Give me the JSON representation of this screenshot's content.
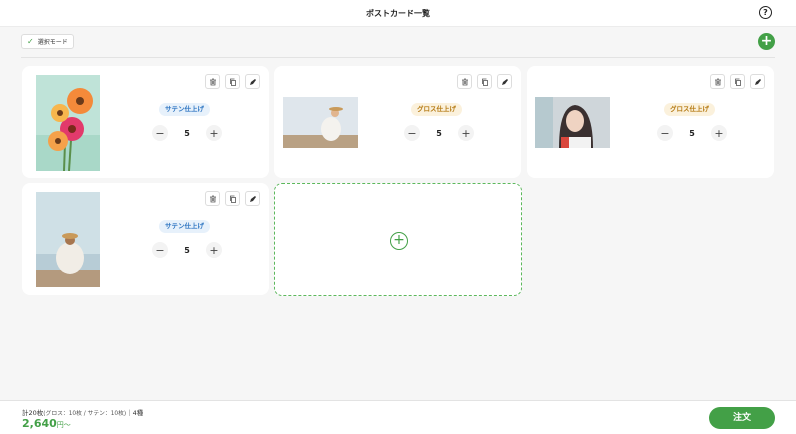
{
  "header": {
    "title": "ポストカード一覧",
    "help_label": "?"
  },
  "toolbar": {
    "select_mode_label": "選択モード",
    "add_label": "+"
  },
  "colors": {
    "accent": "#43a047",
    "satin": "#2f76c2",
    "gloss": "#b57a12"
  },
  "cards": [
    {
      "finish": "サテン仕上げ",
      "finish_type": "satin",
      "quantity": "5",
      "orientation": "portrait",
      "photo": "flower bouquet"
    },
    {
      "finish": "グロス仕上げ",
      "finish_type": "gloss",
      "quantity": "5",
      "orientation": "landscape",
      "photo": "woman in sun hat"
    },
    {
      "finish": "グロス仕上げ",
      "finish_type": "gloss",
      "quantity": "5",
      "orientation": "landscape",
      "photo": "woman portrait"
    },
    {
      "finish": "サテン仕上げ",
      "finish_type": "satin",
      "quantity": "5",
      "orientation": "portrait",
      "photo": "woman sitting by sea"
    }
  ],
  "stepper": {
    "minus": "−",
    "plus": "+"
  },
  "add_card": {
    "plus": "+"
  },
  "footer": {
    "summary_main": "計20枚",
    "summary_detail": "(グロス：10枚 / サテン：10枚)",
    "summary_kinds": "｜4種",
    "price": "2,640",
    "price_unit": "円〜",
    "order_label": "注文"
  }
}
